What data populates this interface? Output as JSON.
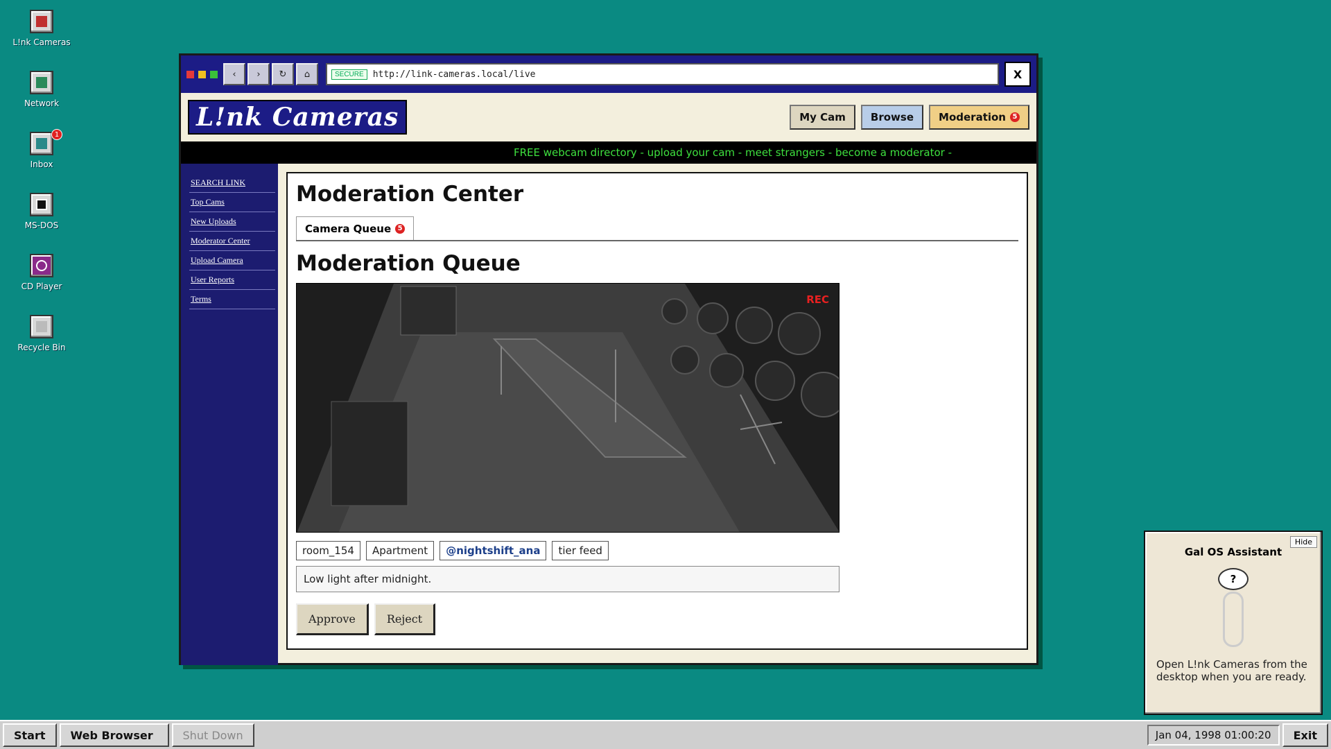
{
  "desktop": {
    "icons": [
      {
        "label": "L!nk Cameras",
        "icon": "link-cameras-icon",
        "color": "#c03030"
      },
      {
        "label": "Network",
        "icon": "network-icon",
        "color": "#2a8a5a"
      },
      {
        "label": "Inbox",
        "icon": "inbox-icon",
        "color": "#2a8a8a",
        "badge": "1"
      },
      {
        "label": "MS-DOS",
        "icon": "msdos-icon",
        "color": "#111111"
      },
      {
        "label": "CD Player",
        "icon": "cd-player-icon",
        "color": "#8a2a8a"
      },
      {
        "label": "Recycle Bin",
        "icon": "recycle-bin-icon",
        "color": "#bbbbbb"
      }
    ]
  },
  "browser": {
    "url": "http://link-cameras.local/live",
    "secure_label": "SECURE",
    "close_label": "X",
    "nav": {
      "back": "‹",
      "forward": "›",
      "reload": "↻",
      "home": "⌂"
    }
  },
  "site": {
    "logo": "L!nk Cameras",
    "header_buttons": {
      "my_cam": "My Cam",
      "browse": "Browse",
      "moderation": "Moderation",
      "moderation_count": "5"
    },
    "ticker": "FREE webcam directory - upload your cam - meet strangers - become a moderator -",
    "sidebar": [
      "SEARCH LINK",
      "Top Cams",
      "New Uploads",
      "Moderator Center",
      "Upload Camera",
      "User Reports",
      "Terms"
    ]
  },
  "main": {
    "title": "Moderation Center",
    "tab_label": "Camera Queue",
    "tab_count": "5",
    "queue_title": "Moderation Queue",
    "feed": {
      "rec_label": "REC"
    },
    "tags": {
      "room": "room_154",
      "type": "Apartment",
      "handle": "@nightshift_ana",
      "tier": "tier feed"
    },
    "note": "Low light after midnight.",
    "approve_label": "Approve",
    "reject_label": "Reject"
  },
  "assistant": {
    "hide_label": "Hide",
    "title": "Gal OS Assistant",
    "bubble": "?",
    "message": "Open L!nk Cameras from the desktop when you are ready."
  },
  "taskbar": {
    "start": "Start",
    "web_browser": "Web Browser",
    "shut_down": "Shut Down",
    "clock": "Jan 04, 1998 01:00:20",
    "exit": "Exit"
  },
  "colors": {
    "desktop": "#0a8a82",
    "window_titlebar": "#1c1c86",
    "ticker_text": "#3ee03e",
    "rec": "#e82020"
  }
}
